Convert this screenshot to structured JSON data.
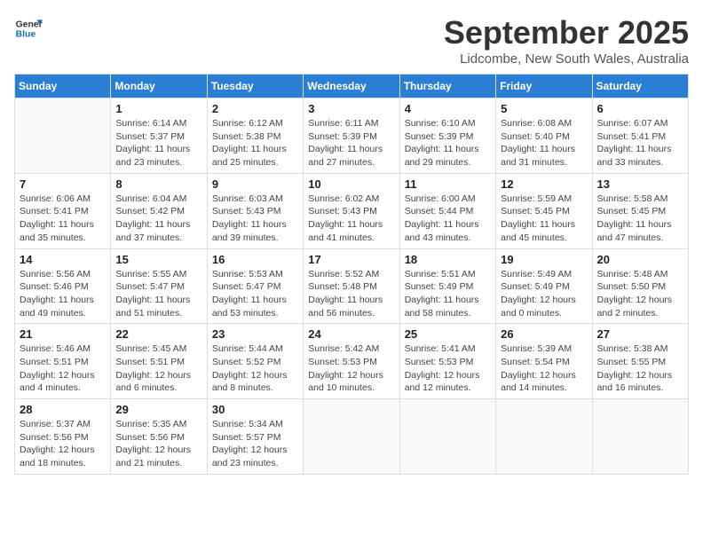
{
  "header": {
    "logo_line1": "General",
    "logo_line2": "Blue",
    "month": "September 2025",
    "location": "Lidcombe, New South Wales, Australia"
  },
  "weekdays": [
    "Sunday",
    "Monday",
    "Tuesday",
    "Wednesday",
    "Thursday",
    "Friday",
    "Saturday"
  ],
  "weeks": [
    [
      {
        "day": "",
        "info": ""
      },
      {
        "day": "1",
        "info": "Sunrise: 6:14 AM\nSunset: 5:37 PM\nDaylight: 11 hours\nand 23 minutes."
      },
      {
        "day": "2",
        "info": "Sunrise: 6:12 AM\nSunset: 5:38 PM\nDaylight: 11 hours\nand 25 minutes."
      },
      {
        "day": "3",
        "info": "Sunrise: 6:11 AM\nSunset: 5:39 PM\nDaylight: 11 hours\nand 27 minutes."
      },
      {
        "day": "4",
        "info": "Sunrise: 6:10 AM\nSunset: 5:39 PM\nDaylight: 11 hours\nand 29 minutes."
      },
      {
        "day": "5",
        "info": "Sunrise: 6:08 AM\nSunset: 5:40 PM\nDaylight: 11 hours\nand 31 minutes."
      },
      {
        "day": "6",
        "info": "Sunrise: 6:07 AM\nSunset: 5:41 PM\nDaylight: 11 hours\nand 33 minutes."
      }
    ],
    [
      {
        "day": "7",
        "info": "Sunrise: 6:06 AM\nSunset: 5:41 PM\nDaylight: 11 hours\nand 35 minutes."
      },
      {
        "day": "8",
        "info": "Sunrise: 6:04 AM\nSunset: 5:42 PM\nDaylight: 11 hours\nand 37 minutes."
      },
      {
        "day": "9",
        "info": "Sunrise: 6:03 AM\nSunset: 5:43 PM\nDaylight: 11 hours\nand 39 minutes."
      },
      {
        "day": "10",
        "info": "Sunrise: 6:02 AM\nSunset: 5:43 PM\nDaylight: 11 hours\nand 41 minutes."
      },
      {
        "day": "11",
        "info": "Sunrise: 6:00 AM\nSunset: 5:44 PM\nDaylight: 11 hours\nand 43 minutes."
      },
      {
        "day": "12",
        "info": "Sunrise: 5:59 AM\nSunset: 5:45 PM\nDaylight: 11 hours\nand 45 minutes."
      },
      {
        "day": "13",
        "info": "Sunrise: 5:58 AM\nSunset: 5:45 PM\nDaylight: 11 hours\nand 47 minutes."
      }
    ],
    [
      {
        "day": "14",
        "info": "Sunrise: 5:56 AM\nSunset: 5:46 PM\nDaylight: 11 hours\nand 49 minutes."
      },
      {
        "day": "15",
        "info": "Sunrise: 5:55 AM\nSunset: 5:47 PM\nDaylight: 11 hours\nand 51 minutes."
      },
      {
        "day": "16",
        "info": "Sunrise: 5:53 AM\nSunset: 5:47 PM\nDaylight: 11 hours\nand 53 minutes."
      },
      {
        "day": "17",
        "info": "Sunrise: 5:52 AM\nSunset: 5:48 PM\nDaylight: 11 hours\nand 56 minutes."
      },
      {
        "day": "18",
        "info": "Sunrise: 5:51 AM\nSunset: 5:49 PM\nDaylight: 11 hours\nand 58 minutes."
      },
      {
        "day": "19",
        "info": "Sunrise: 5:49 AM\nSunset: 5:49 PM\nDaylight: 12 hours\nand 0 minutes."
      },
      {
        "day": "20",
        "info": "Sunrise: 5:48 AM\nSunset: 5:50 PM\nDaylight: 12 hours\nand 2 minutes."
      }
    ],
    [
      {
        "day": "21",
        "info": "Sunrise: 5:46 AM\nSunset: 5:51 PM\nDaylight: 12 hours\nand 4 minutes."
      },
      {
        "day": "22",
        "info": "Sunrise: 5:45 AM\nSunset: 5:51 PM\nDaylight: 12 hours\nand 6 minutes."
      },
      {
        "day": "23",
        "info": "Sunrise: 5:44 AM\nSunset: 5:52 PM\nDaylight: 12 hours\nand 8 minutes."
      },
      {
        "day": "24",
        "info": "Sunrise: 5:42 AM\nSunset: 5:53 PM\nDaylight: 12 hours\nand 10 minutes."
      },
      {
        "day": "25",
        "info": "Sunrise: 5:41 AM\nSunset: 5:53 PM\nDaylight: 12 hours\nand 12 minutes."
      },
      {
        "day": "26",
        "info": "Sunrise: 5:39 AM\nSunset: 5:54 PM\nDaylight: 12 hours\nand 14 minutes."
      },
      {
        "day": "27",
        "info": "Sunrise: 5:38 AM\nSunset: 5:55 PM\nDaylight: 12 hours\nand 16 minutes."
      }
    ],
    [
      {
        "day": "28",
        "info": "Sunrise: 5:37 AM\nSunset: 5:56 PM\nDaylight: 12 hours\nand 18 minutes."
      },
      {
        "day": "29",
        "info": "Sunrise: 5:35 AM\nSunset: 5:56 PM\nDaylight: 12 hours\nand 21 minutes."
      },
      {
        "day": "30",
        "info": "Sunrise: 5:34 AM\nSunset: 5:57 PM\nDaylight: 12 hours\nand 23 minutes."
      },
      {
        "day": "",
        "info": ""
      },
      {
        "day": "",
        "info": ""
      },
      {
        "day": "",
        "info": ""
      },
      {
        "day": "",
        "info": ""
      }
    ]
  ]
}
